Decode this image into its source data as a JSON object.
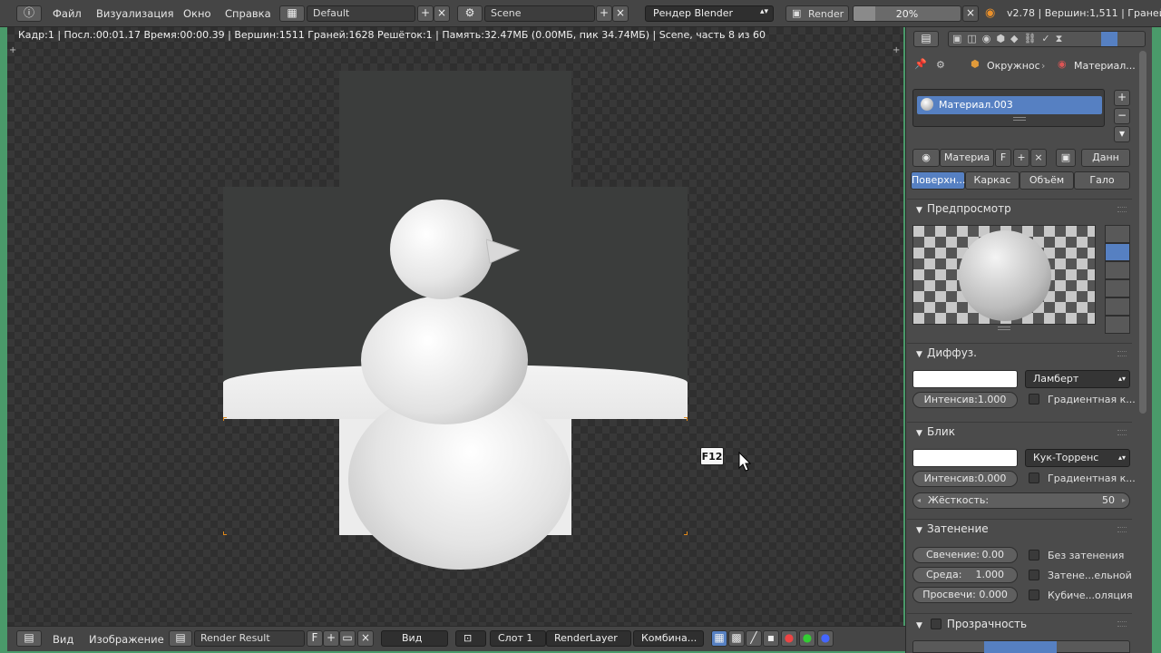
{
  "topbar": {
    "menus": [
      "Файл",
      "Визуализация",
      "Окно",
      "Справка"
    ],
    "layout": "Default",
    "scene": "Scene",
    "engine": "Рендер Blender",
    "render_label": "Render",
    "progress_label": "20%",
    "progress_fraction": 0.2,
    "version": "v2.78 | Вершин:1,511 | Граней"
  },
  "info_line": "Кадр:1 | Посл.:00:01.17 Время:00:00.39 | Вершин:1511 Граней:1628 Решёток:1 | Память:32.47МБ (0.00МБ, пик 34.74МБ) | Scene, часть 8 из 60",
  "key_hint": "F12",
  "bottombar": {
    "view": "Вид",
    "image": "Изображение",
    "image_name": "Render Result",
    "fake_user": "F",
    "view_dropdown": "Вид",
    "slot": "Слот 1",
    "layer": "RenderLayer",
    "pass": "Комбина..."
  },
  "props": {
    "context_path": [
      "Окружнос",
      "Материал..."
    ],
    "material_slot": "Материал.003",
    "material_name": "Материа",
    "fake_user": "F",
    "data_dropdown": "Данн",
    "tabs": [
      "Поверхн...",
      "Каркас",
      "Объём",
      "Гало"
    ],
    "preview_header": "Предпросмотр",
    "diffuse": {
      "header": "Диффуз.",
      "shader": "Ламберт",
      "intensity": "Интенсив:1.000",
      "ramp": "Градиентная к..."
    },
    "specular": {
      "header": "Блик",
      "shader": "Кук-Торренс",
      "intensity": "Интенсив:0.000",
      "ramp": "Градиентная к...",
      "hardness_label": "Жёсткость:",
      "hardness_value": "50"
    },
    "shading": {
      "header": "Затенение",
      "emit_label": "Свечение:",
      "emit_value": "0.00",
      "ambient_label": "Среда:",
      "ambient_value": "1.000",
      "translucency": "Просвечи: 0.000",
      "shadeless": "Без затенения",
      "tangent": "Затене...ельной",
      "cubic": "Кубиче...оляция"
    },
    "transparency": {
      "header": "Прозрачность"
    }
  },
  "colors": {
    "accent": "#5680c2",
    "window_border": "#4a9a6a"
  }
}
